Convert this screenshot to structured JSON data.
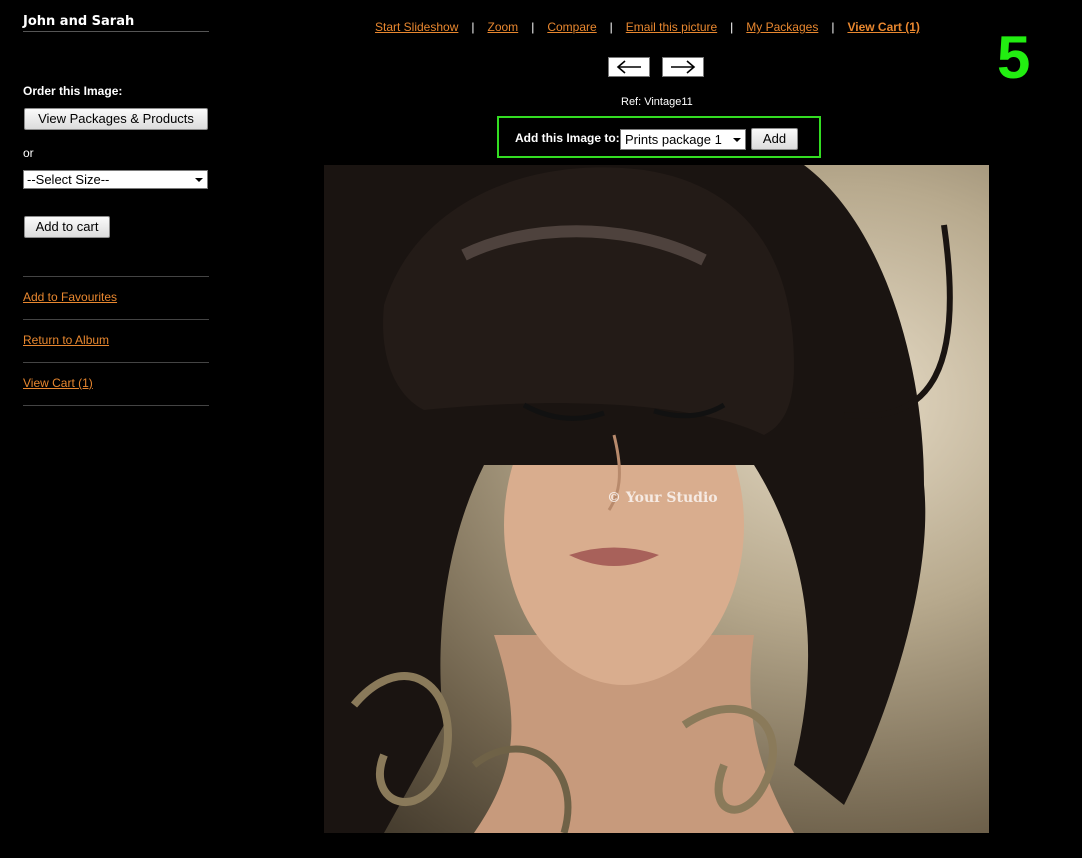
{
  "sidebar": {
    "album_title": "John and Sarah",
    "order_label": "Order this Image:",
    "packages_button": "View Packages & Products",
    "or_label": "or",
    "size_select": "--Select Size--",
    "add_to_cart_button": "Add to cart",
    "links": [
      "Add to Favourites",
      "Return to Album",
      "View Cart (1)"
    ]
  },
  "topnav": {
    "items": [
      "Start Slideshow",
      "Zoom",
      "Compare",
      "Email this picture",
      "My Packages",
      "View Cart (1)"
    ]
  },
  "step_number": "5",
  "ref_label": "Ref: Vintage11",
  "add_box": {
    "label": "Add this Image to:",
    "package_select": "Prints package 1",
    "add_button": "Add"
  },
  "photo": {
    "watermark": "© Your Studio"
  },
  "colors": {
    "link": "#e8872f",
    "highlight": "#33dd22",
    "background": "#000000"
  },
  "icons": {
    "prev": "arrow-left-icon",
    "next": "arrow-right-icon"
  }
}
